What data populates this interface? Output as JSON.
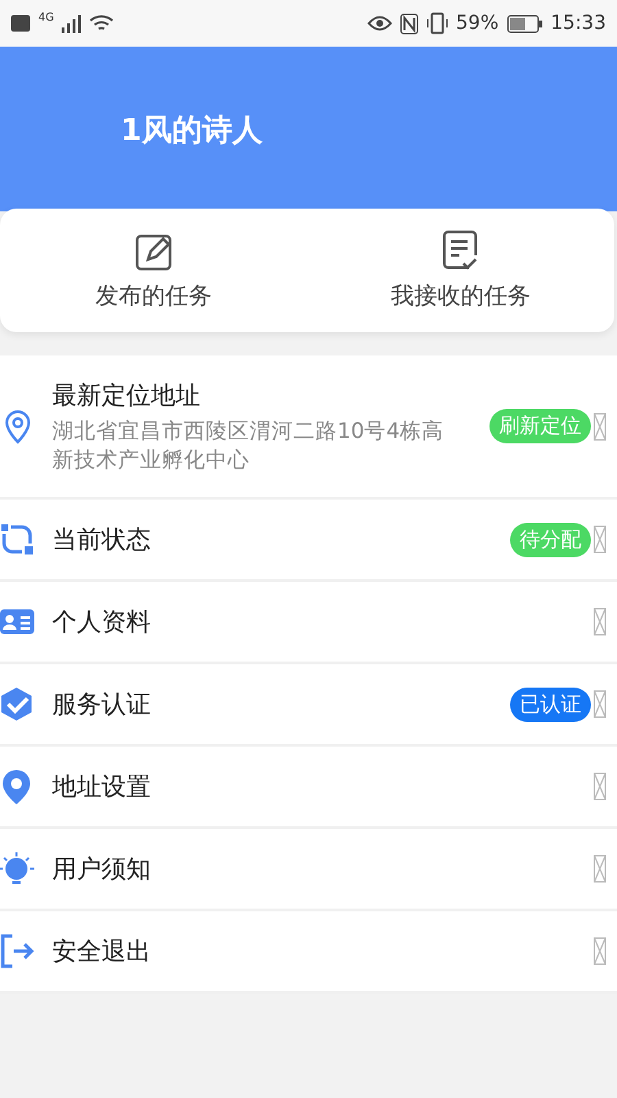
{
  "status_bar": {
    "network": "4G",
    "battery": "59%",
    "time": "15:33"
  },
  "header": {
    "username": "1风的诗人"
  },
  "shortcuts": [
    {
      "kind": "edit",
      "label": "发布的任务"
    },
    {
      "kind": "checklist",
      "label": "我接收的任务"
    }
  ],
  "menu": [
    {
      "kind": "location",
      "title": "最新定位地址",
      "subtitle": "湖北省宜昌市西陵区渭河二路10号4栋高新技术产业孵化中心",
      "badge": {
        "text": "刷新定位",
        "color": "#4cd964"
      }
    },
    {
      "kind": "status",
      "title": "当前状态",
      "badge": {
        "text": "待分配",
        "color": "#4cd964"
      }
    },
    {
      "kind": "profile",
      "title": "个人资料"
    },
    {
      "kind": "verified",
      "title": "服务认证",
      "badge": {
        "text": "已认证",
        "color": "#1677f5"
      }
    },
    {
      "kind": "address",
      "title": "地址设置"
    },
    {
      "kind": "notice",
      "title": "用户须知"
    },
    {
      "kind": "logout",
      "title": "安全退出"
    }
  ]
}
